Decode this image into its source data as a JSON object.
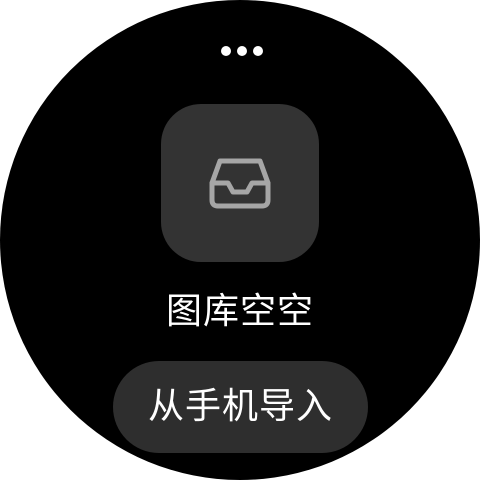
{
  "screen": {
    "more_icon": "more-horizontal-dots-icon",
    "empty_icon": "inbox-tray-icon",
    "empty_label": "图库空空",
    "import_button_label": "从手机导入"
  },
  "colors": {
    "background": "#000000",
    "tile": "#333333",
    "icon_stroke": "#a6a6a6",
    "button": "#2e2e2e",
    "text": "#ffffff"
  }
}
